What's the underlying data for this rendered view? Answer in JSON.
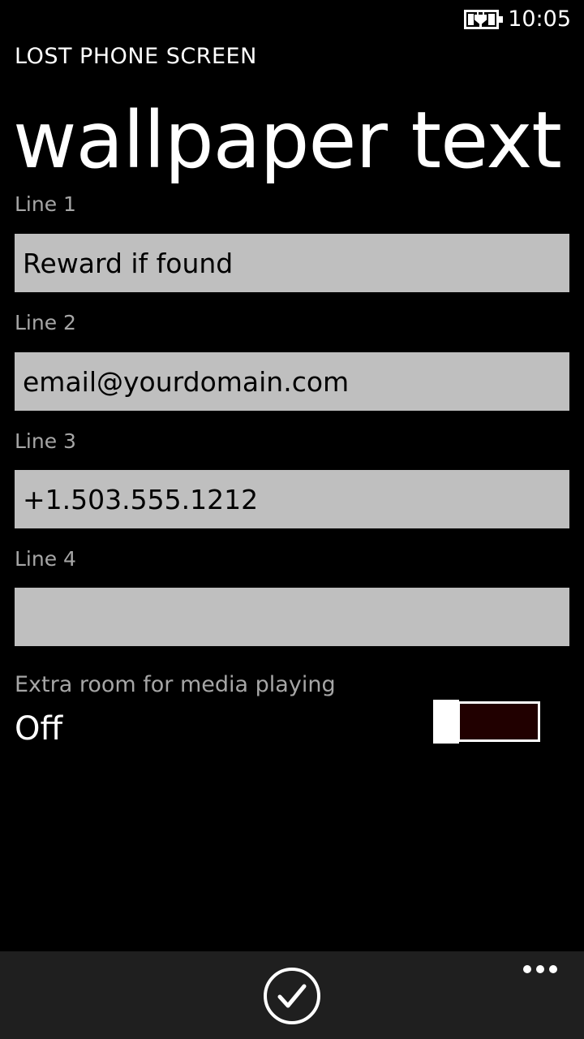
{
  "status_bar": {
    "time": "10:05",
    "battery_icon": "battery-charging-icon"
  },
  "header": {
    "app_title": "LOST PHONE SCREEN",
    "page_title": "wallpaper text"
  },
  "fields": [
    {
      "label": "Line 1",
      "value": "Reward if found"
    },
    {
      "label": "Line 2",
      "value": "email@yourdomain.com"
    },
    {
      "label": "Line 3",
      "value": "+1.503.555.1212"
    },
    {
      "label": "Line 4",
      "value": ""
    }
  ],
  "toggle": {
    "label": "Extra room for media playing",
    "state_text": "Off",
    "on": false,
    "track_color": "#210000"
  },
  "app_bar": {
    "check_icon": "check-circle-icon",
    "more_icon": "ellipsis-icon",
    "background": "#1f1f1f"
  }
}
